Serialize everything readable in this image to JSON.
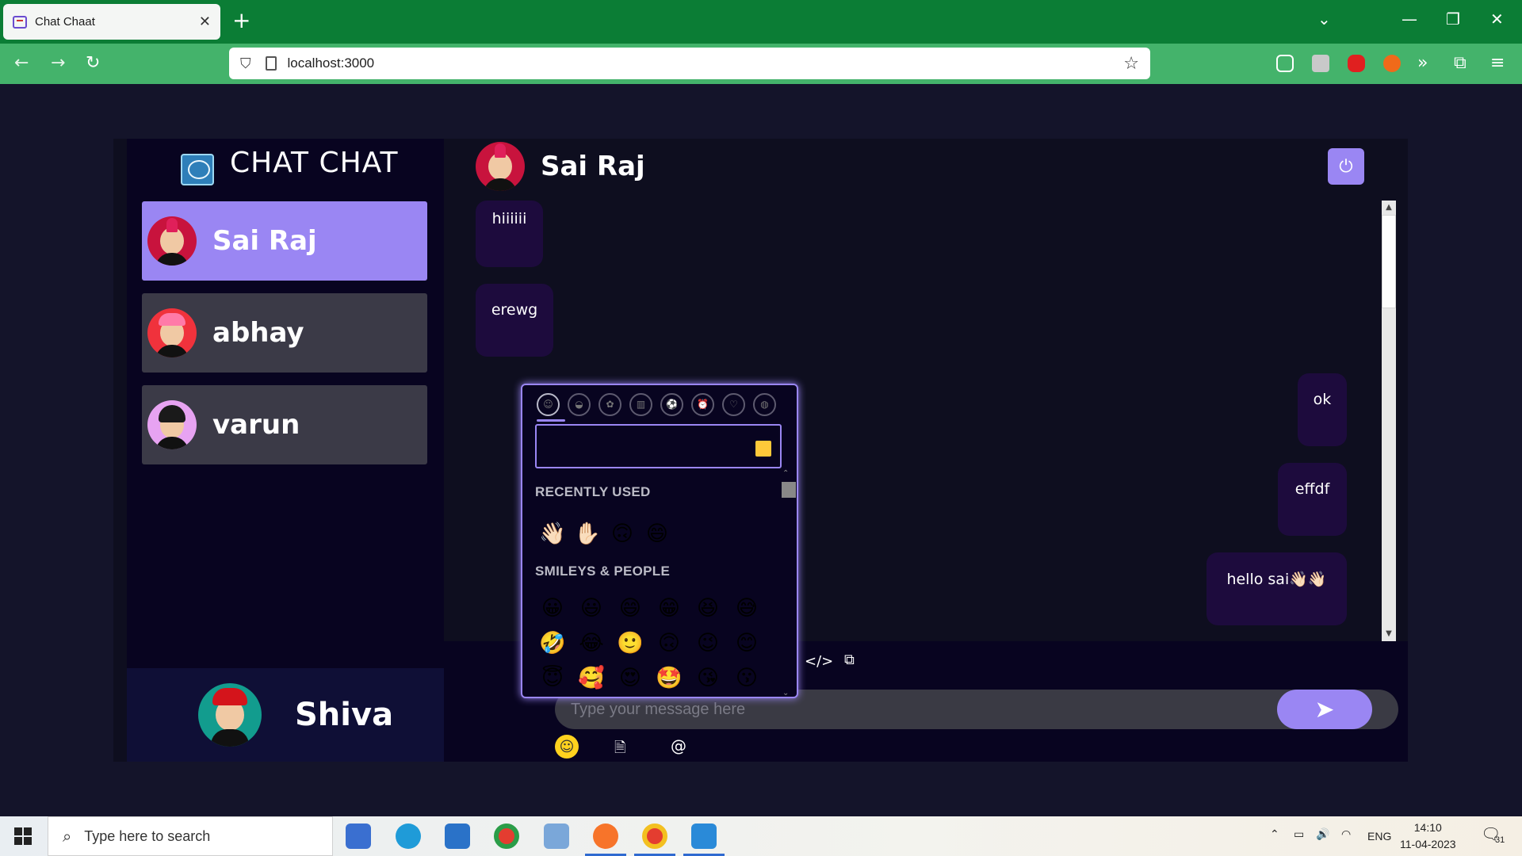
{
  "browser": {
    "tab_title": "Chat Chaat",
    "tab_close": "✕",
    "new_tab": "+",
    "url": "localhost:3000",
    "window_controls": [
      "⌄",
      "—",
      "❐",
      "✕"
    ]
  },
  "app": {
    "brand": "CHAT CHAT",
    "contacts": [
      {
        "name": "Sai Raj",
        "selected": true,
        "avatar_hair": "#e0205a",
        "avatar_bg": "#c8133d"
      },
      {
        "name": "abhay",
        "selected": false,
        "avatar_hair": "#ff7aa8",
        "avatar_bg": "#f0323c"
      },
      {
        "name": "varun",
        "selected": false,
        "avatar_hair": "#1a1a1a",
        "avatar_bg": "#e7a3f2"
      }
    ],
    "current_user": {
      "name": "Shiva",
      "avatar_bg": "#129c8e",
      "avatar_hair": "#d4141b"
    },
    "chat_header": {
      "name": "Sai Raj"
    },
    "logout_icon": "⏻",
    "messages": [
      {
        "text": "hiiiiii",
        "direction": "received"
      },
      {
        "text": "erewg",
        "direction": "received"
      },
      {
        "text": "ok",
        "direction": "sent"
      },
      {
        "text": "effdf",
        "direction": "sent"
      },
      {
        "text": "hello sai👋🏻👋🏻",
        "direction": "sent"
      }
    ],
    "input": {
      "placeholder": "Type your message here",
      "value": ""
    },
    "send_icon": "➤",
    "toolbar_icons": {
      "code": "</>",
      "embed": "⧉",
      "file": "🗎",
      "mention": "@"
    }
  },
  "emoji_picker": {
    "categories": [
      "☺",
      "◒",
      "✿",
      "▥",
      "⚽",
      "⏰",
      "♡",
      "◍"
    ],
    "search_value": "",
    "recently_used_title": "RECENTLY USED",
    "recently_used": [
      "👋🏻",
      "✋🏻",
      "🙃",
      "😄"
    ],
    "smileys_title": "SMILEYS & PEOPLE",
    "smileys": [
      "😀",
      "😃",
      "😄",
      "😁",
      "😆",
      "😅",
      "🤣",
      "😂",
      "🙂",
      "🙃",
      "😉",
      "😊",
      "😇",
      "🥰",
      "😍",
      "🤩",
      "😘",
      "😗"
    ],
    "colors": {
      "accent": "#9a86f3",
      "background": "#080420"
    }
  },
  "taskbar": {
    "search_placeholder": "Type here to search",
    "language": "ENG",
    "time": "14:10",
    "date": "11-04-2023",
    "notifications": "31"
  }
}
